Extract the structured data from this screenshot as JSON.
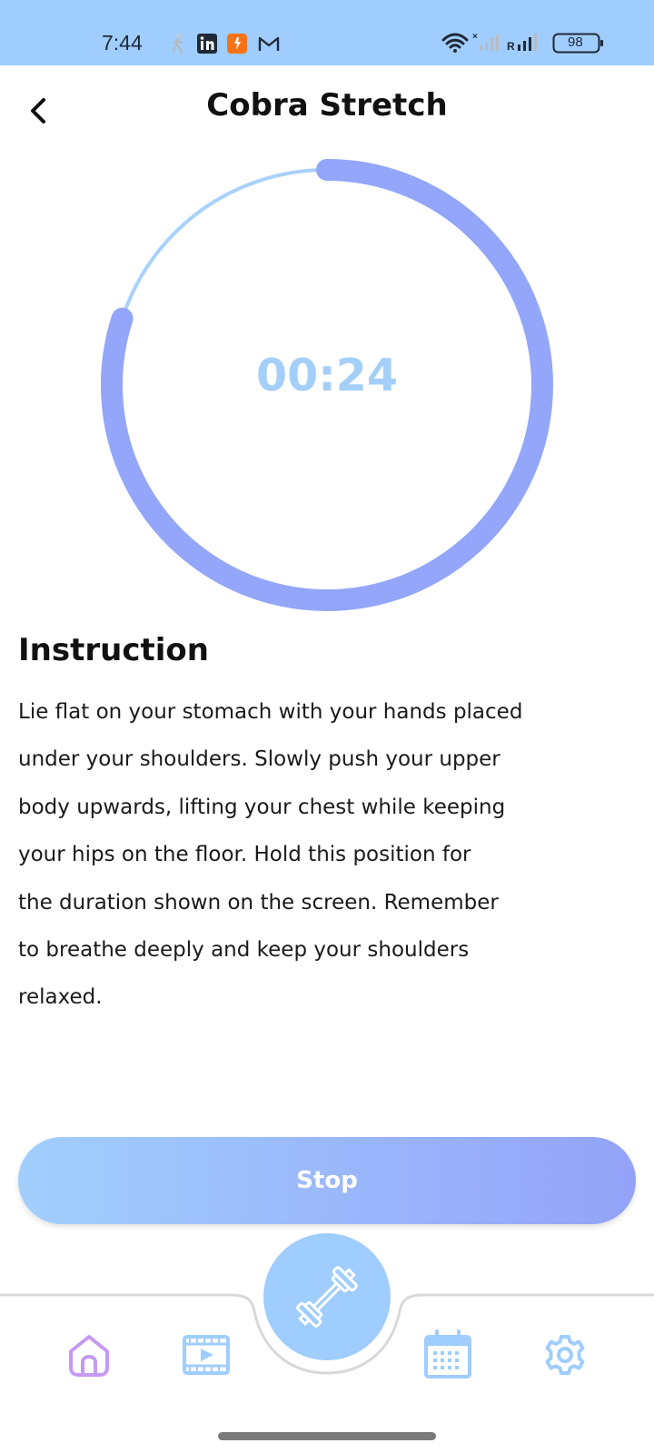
{
  "status_bar": {
    "time": "7:44",
    "battery": "98",
    "icons": [
      "walking-icon",
      "linkedin-icon",
      "app-icon",
      "gmail-icon",
      "wifi-icon",
      "signal-icon",
      "signal-icon",
      "battery-icon"
    ]
  },
  "header": {
    "title": "Cobra Stretch",
    "back_icon": "chevron-left-icon"
  },
  "timer": {
    "display": "00:24",
    "progress_fraction": 0.8
  },
  "instruction": {
    "heading": "Instruction",
    "lines": [
      "Lie flat on your stomach with your hands placed",
      "under your shoulders. Slowly push your upper",
      "body upwards, lifting your chest while keeping",
      "your hips on the floor. Hold this position for",
      "the duration shown on the screen. Remember",
      "to breathe deeply and keep your shoulders",
      "relaxed."
    ]
  },
  "actions": {
    "stop_label": "Stop"
  },
  "bottom_nav": {
    "items": [
      {
        "icon": "home-icon"
      },
      {
        "icon": "video-icon"
      },
      {
        "icon": "dumbbell-icon"
      },
      {
        "icon": "calendar-icon"
      },
      {
        "icon": "gear-icon"
      }
    ]
  },
  "colors": {
    "status_bar": "#9fcdfd",
    "ring_track": "#a8d1fb",
    "ring_progress": "#93a6f9",
    "timer_text": "#a4cff8",
    "home_icon": "#c49af4",
    "nav_icons": "#9fcdfd",
    "button_gradient_start": "#a1cffc",
    "button_gradient_end": "#93a3f8"
  }
}
